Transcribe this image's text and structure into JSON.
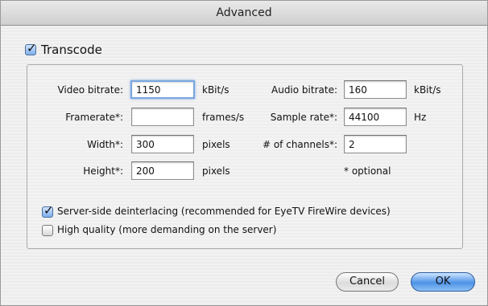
{
  "window": {
    "title": "Advanced"
  },
  "transcode": {
    "label": "Transcode",
    "checked": true
  },
  "fields": {
    "video_bitrate": {
      "label": "Video bitrate:",
      "value": "1150",
      "unit": "kBit/s"
    },
    "framerate": {
      "label": "Framerate*:",
      "value": "",
      "unit": "frames/s"
    },
    "width": {
      "label": "Width*:",
      "value": "300",
      "unit": "pixels"
    },
    "height": {
      "label": "Height*:",
      "value": "200",
      "unit": "pixels"
    },
    "audio_bitrate": {
      "label": "Audio bitrate:",
      "value": "160",
      "unit": "kBit/s"
    },
    "sample_rate": {
      "label": "Sample rate*:",
      "value": "44100",
      "unit": "Hz"
    },
    "channels": {
      "label": "# of channels*:",
      "value": "2"
    }
  },
  "optional_note": "* optional",
  "options": {
    "deinterlacing": {
      "label": "Server-side deinterlacing (recommended for EyeTV FireWire devices)",
      "checked": true
    },
    "high_quality": {
      "label": "High quality (more demanding on the server)",
      "checked": false
    }
  },
  "buttons": {
    "cancel": "Cancel",
    "ok": "OK"
  },
  "colors": {
    "accent": "#4d92e6",
    "focus": "#7aa7e0"
  }
}
